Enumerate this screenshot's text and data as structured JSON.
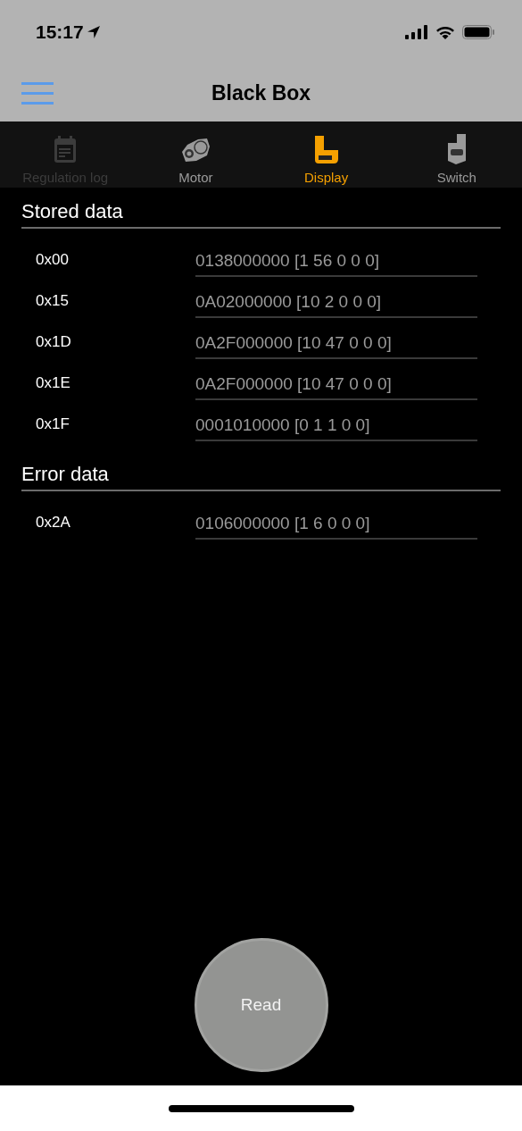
{
  "status_bar": {
    "time": "15:17"
  },
  "nav_bar": {
    "title": "Black Box"
  },
  "tabs": [
    {
      "label": "Regulation log",
      "selected": false,
      "disabled": true
    },
    {
      "label": "Motor",
      "selected": false,
      "disabled": false
    },
    {
      "label": "Display",
      "selected": true,
      "disabled": false
    },
    {
      "label": "Switch",
      "selected": false,
      "disabled": false
    }
  ],
  "sections": [
    {
      "title": "Stored data",
      "rows": [
        {
          "address": "0x00",
          "value": "0138000000 [1 56 0 0 0]"
        },
        {
          "address": "0x15",
          "value": "0A02000000 [10 2 0 0 0]"
        },
        {
          "address": "0x1D",
          "value": "0A2F000000 [10 47 0 0 0]"
        },
        {
          "address": "0x1E",
          "value": "0A2F000000 [10 47 0 0 0]"
        },
        {
          "address": "0x1F",
          "value": "0001010000 [0 1 1 0 0]"
        }
      ]
    },
    {
      "title": "Error data",
      "rows": [
        {
          "address": "0x2A",
          "value": "0106000000 [1 6 0 0 0]"
        }
      ]
    }
  ],
  "read_button": {
    "label": "Read"
  }
}
